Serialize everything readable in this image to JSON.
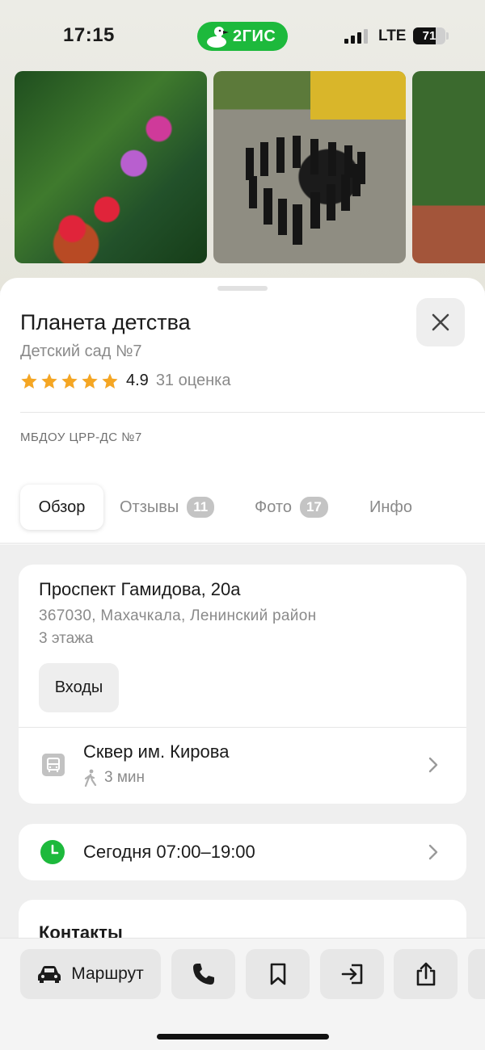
{
  "status_bar": {
    "time": "17:15",
    "app_name": "2ГИС",
    "network": "LTE",
    "battery": "71",
    "battery_fraction": 0.71
  },
  "photos": [
    {
      "name": "photo-garden-flowers"
    },
    {
      "name": "photo-group-heart"
    },
    {
      "name": "photo-playground"
    }
  ],
  "place": {
    "title": "Планета детства",
    "subtitle": "Детский сад №7",
    "rating_value": "4.9",
    "rating_stars": 4.9,
    "rating_count": "31 оценка",
    "org_name": "МБДОУ ЦРР-ДС №7"
  },
  "tabs": [
    {
      "label": "Обзор",
      "count": ""
    },
    {
      "label": "Отзывы",
      "count": "11"
    },
    {
      "label": "Фото",
      "count": "17"
    },
    {
      "label": "Инфо",
      "count": ""
    }
  ],
  "address": {
    "main": "Проспект Гамидова, 20а",
    "sub": "367030, Махачкала, Ленинский район",
    "floors": "3 этажа",
    "entrances_label": "Входы"
  },
  "transport": {
    "stop_name": "Сквер им. Кирова",
    "walk_time": "3 мин"
  },
  "hours": {
    "text": "Сегодня 07:00–19:00"
  },
  "contacts": {
    "title": "Контакты"
  },
  "bottom_bar": {
    "route_label": "Маршрут"
  },
  "colors": {
    "brand_green": "#1db93c",
    "star": "#f5a623"
  },
  "icons": [
    "close-icon",
    "star-icon",
    "bus-stop-icon",
    "walk-icon",
    "chevron-right-icon",
    "clock-icon",
    "car-icon",
    "phone-icon",
    "bookmark-icon",
    "enter-icon",
    "share-icon"
  ]
}
